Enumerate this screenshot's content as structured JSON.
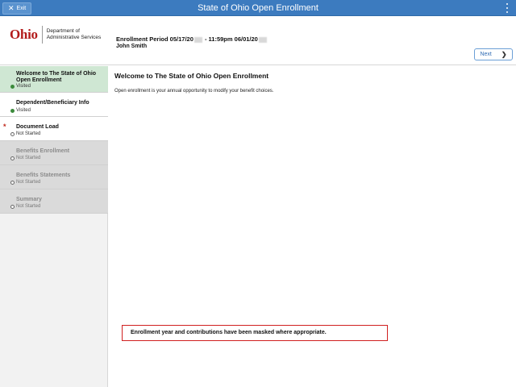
{
  "topbar": {
    "exit_label": "Exit",
    "title": "State of Ohio Open Enrollment"
  },
  "header": {
    "logo_word": "Ohio",
    "logo_dept_line1": "Department of",
    "logo_dept_line2": "Administrative Services",
    "period_prefix": "Enrollment Period 05/17/20",
    "period_middle": " - 11:59pm 06/01/20",
    "employee_name": "John Smith",
    "next_label": "Next"
  },
  "sidebar": {
    "steps": [
      {
        "label": "Welcome to The State of Ohio Open Enrollment",
        "status": "Visited"
      },
      {
        "label": "Dependent/Beneficiary Info",
        "status": "Visited"
      },
      {
        "label": "Document Load",
        "status": "Not Started"
      },
      {
        "label": "Benefits Enrollment",
        "status": "Not Started"
      },
      {
        "label": "Benefits Statements",
        "status": "Not Started"
      },
      {
        "label": "Summary",
        "status": "Not Started"
      }
    ],
    "required_marker": "*"
  },
  "main": {
    "title": "Welcome to The State of Ohio Open Enrollment",
    "body": "Open enrollment is your annual opportunity to modify your benefit choices."
  },
  "note": {
    "text": "Enrollment year and contributions have been masked where appropriate."
  },
  "colors": {
    "topbar": "#3c7bbf",
    "active_step": "#cfe7d3",
    "visited_dot": "#3b8a3b",
    "required": "#c0281b",
    "note_border": "#d02020"
  }
}
